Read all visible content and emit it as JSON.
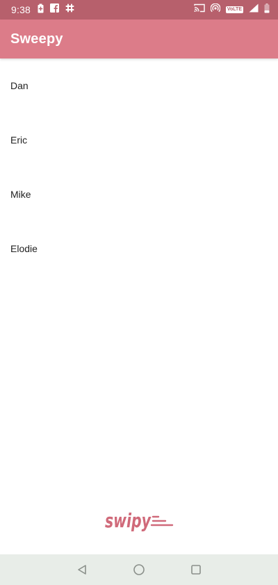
{
  "status_bar": {
    "time": "9:38",
    "left_icons": [
      "battery-saver-icon",
      "facebook-icon",
      "slack-icon"
    ],
    "right_icons": [
      "cast-icon",
      "hotspot-icon",
      "volte-icon",
      "signal-icon",
      "battery-icon"
    ],
    "volte_label": "VoLTE"
  },
  "app_bar": {
    "title": "Sweepy"
  },
  "list": {
    "items": [
      {
        "label": "Dan"
      },
      {
        "label": "Eric"
      },
      {
        "label": "Mike"
      },
      {
        "label": "Elodie"
      }
    ]
  },
  "logo": {
    "text": "swipy",
    "icon": "swipy-logo"
  },
  "nav_bar": {
    "buttons": [
      "back-icon",
      "home-icon",
      "recents-icon"
    ]
  },
  "colors": {
    "status_bar": "#b7606c",
    "app_bar": "#dc7c89",
    "nav_bar": "#e8ede8",
    "logo": "#d06a7a"
  }
}
